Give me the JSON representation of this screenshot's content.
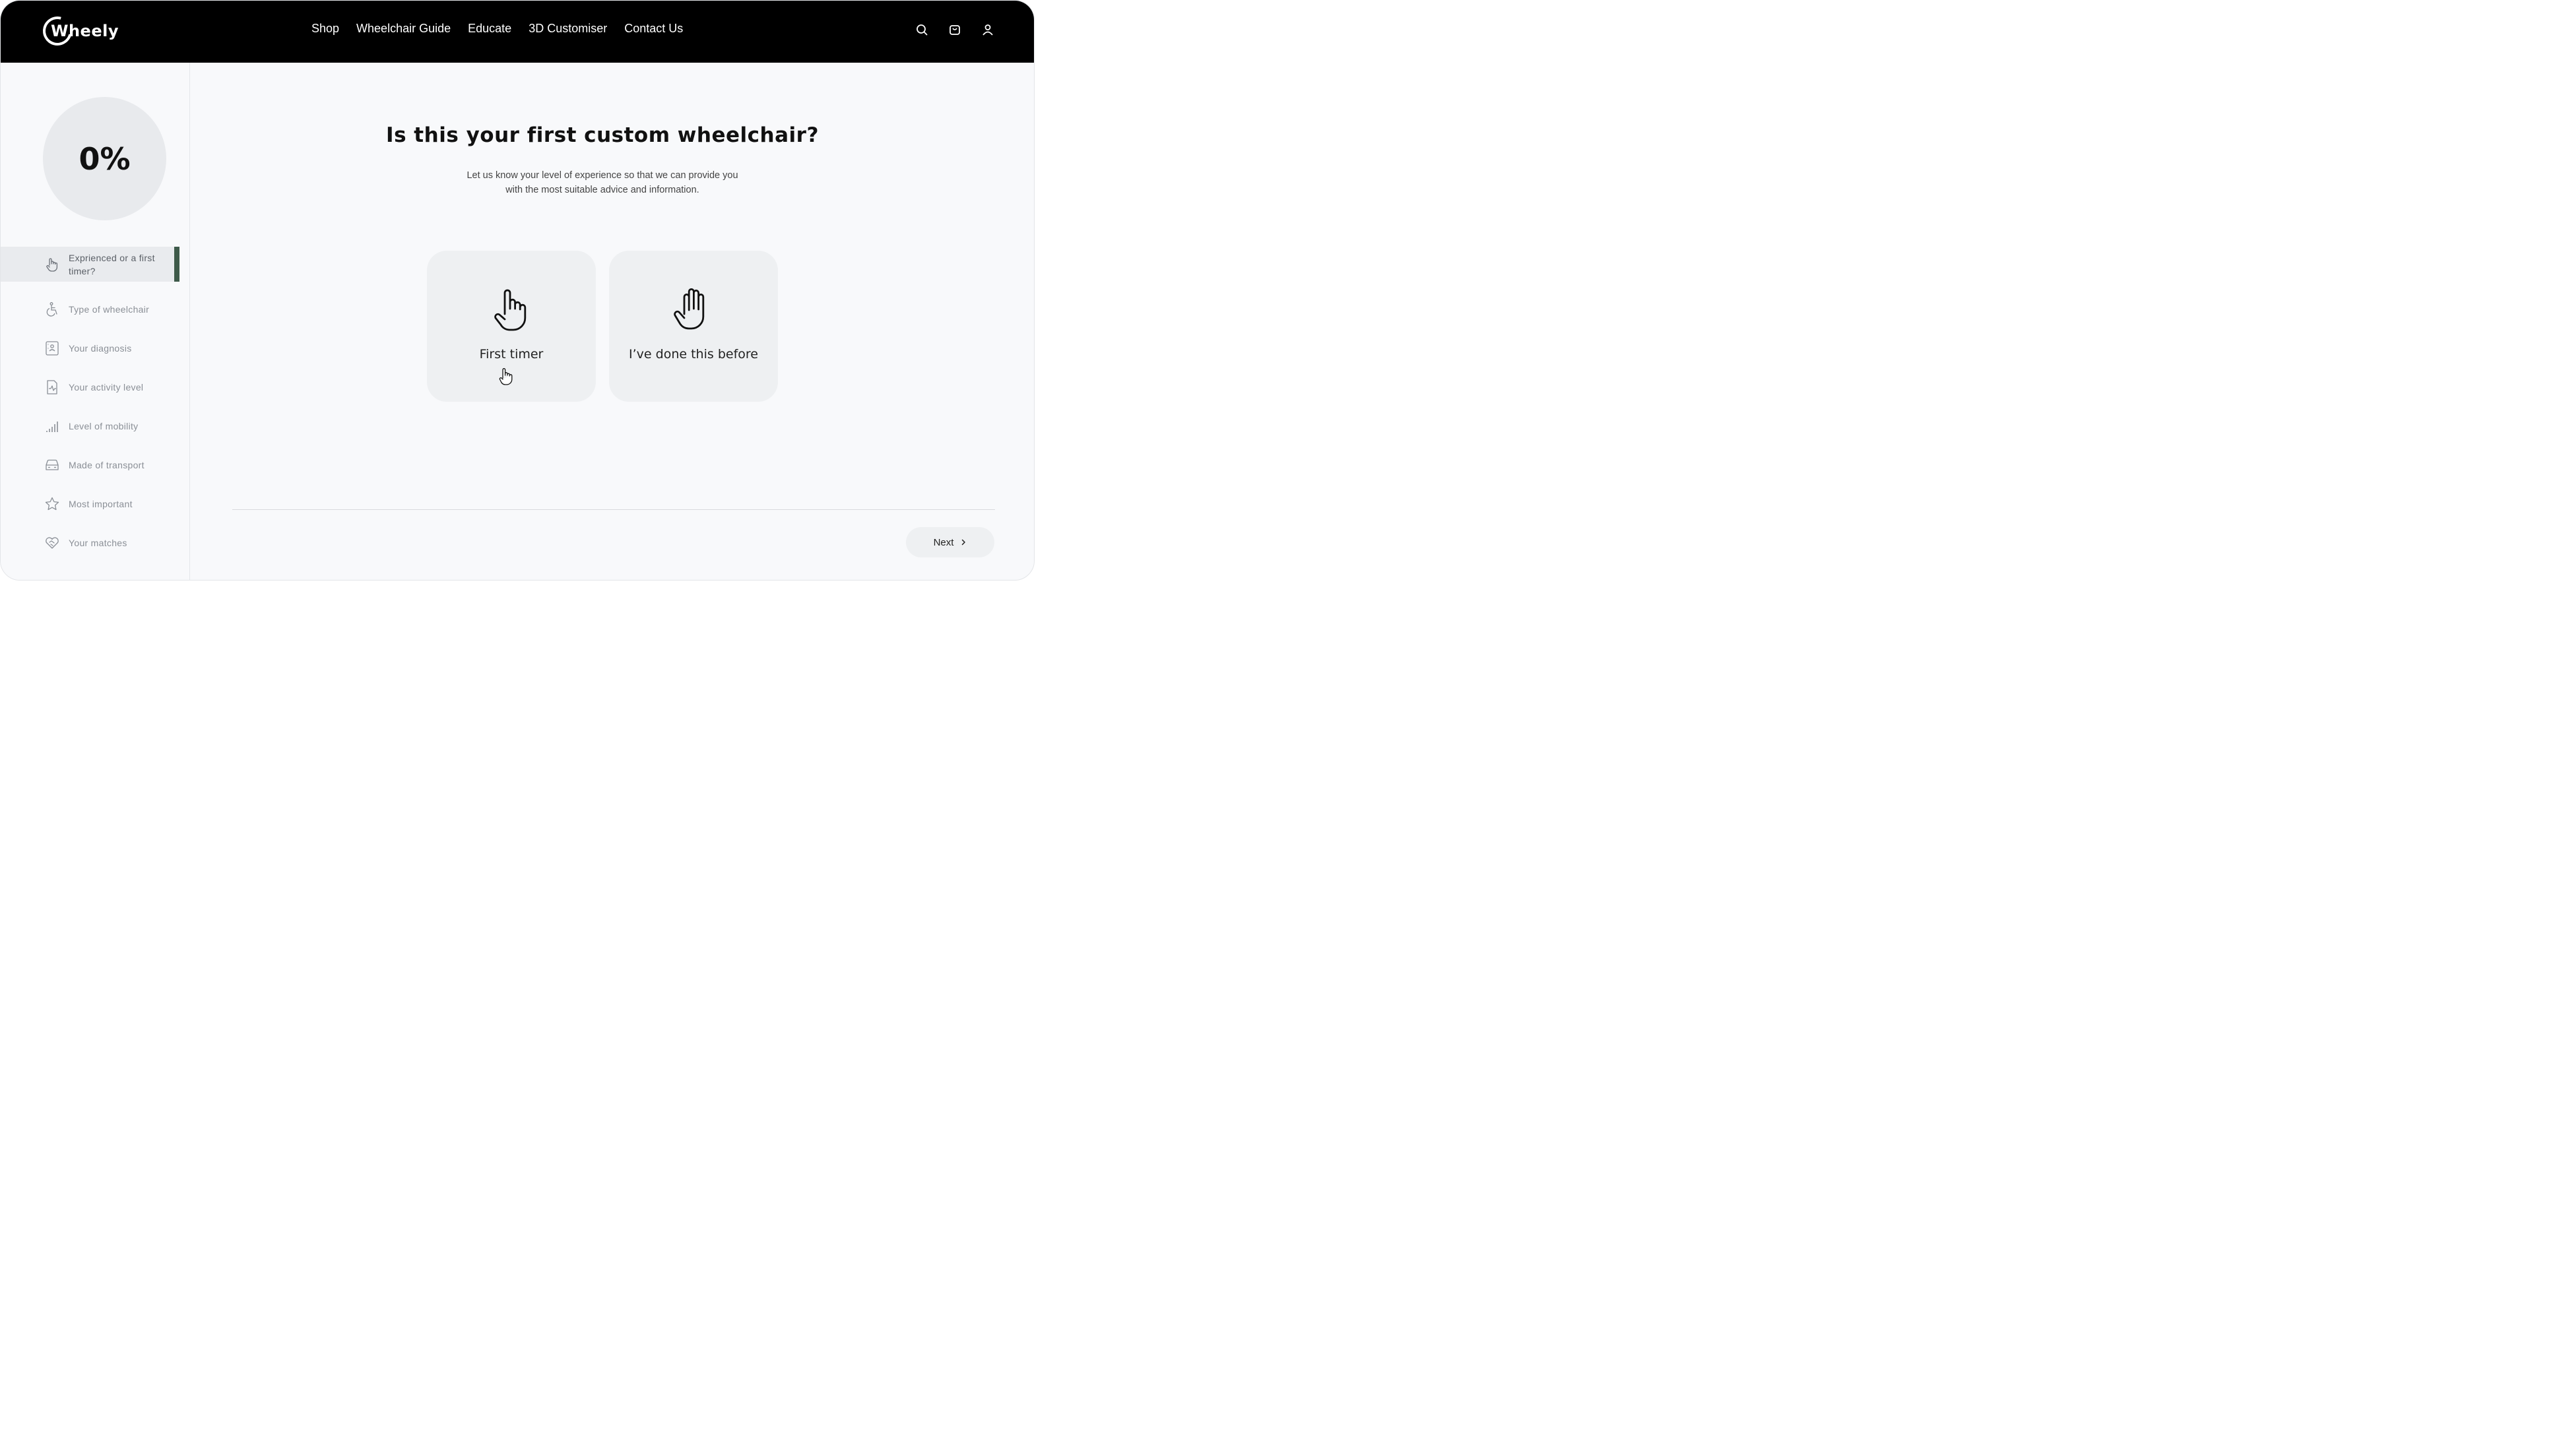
{
  "header": {
    "logo_text": "Wheely",
    "nav": [
      "Shop",
      "Wheelchair Guide",
      "Educate",
      "3D Customiser",
      "Contact Us"
    ],
    "icons": [
      "search-icon",
      "cart-icon",
      "user-icon"
    ]
  },
  "sidebar": {
    "progress_label": "0%",
    "progress_value": 0,
    "steps": [
      {
        "label": "Exprienced or a first timer?",
        "icon": "hand-pointer-icon",
        "active": true
      },
      {
        "label": "Type of wheelchair",
        "icon": "wheelchair-icon",
        "active": false
      },
      {
        "label": "Your diagnosis",
        "icon": "clipboard-icon",
        "active": false
      },
      {
        "label": "Your activity level",
        "icon": "activity-icon",
        "active": false
      },
      {
        "label": "Level of mobility",
        "icon": "signal-bars-icon",
        "active": false
      },
      {
        "label": "Made of transport",
        "icon": "car-icon",
        "active": false
      },
      {
        "label": "Most important",
        "icon": "star-icon",
        "active": false
      },
      {
        "label": "Your matches",
        "icon": "heart-handshake-icon",
        "active": false
      }
    ]
  },
  "main": {
    "title": "Is this your first custom wheelchair?",
    "subtitle_line1": "Let us know your level of experience so that we can provide you",
    "subtitle_line2": "with the most suitable advice and information.",
    "options": [
      {
        "label": "First timer",
        "icon": "pointing-hand-icon"
      },
      {
        "label": "I’ve done this before",
        "icon": "open-hand-icon"
      }
    ],
    "next_label": "Next"
  },
  "colors": {
    "header_bg": "#000000",
    "page_bg": "#f8f9fb",
    "card_bg": "#eef0f2",
    "active_accent": "#3e5a4a"
  }
}
